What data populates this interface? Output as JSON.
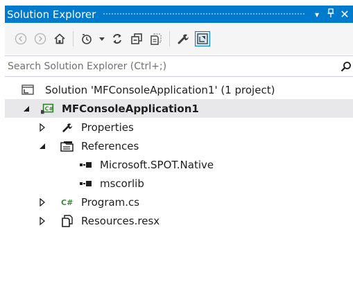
{
  "window": {
    "title": "Solution Explorer",
    "pin_glyph": "॰",
    "dropdown_glyph": "▾",
    "close_glyph": "✕"
  },
  "toolbar": {
    "buttons": [
      {
        "icon": "back-icon"
      },
      {
        "icon": "forward-icon"
      },
      {
        "icon": "home-icon"
      },
      {
        "icon": "pending-changes-filter-icon"
      },
      {
        "icon": "sync-icon"
      },
      {
        "icon": "collapse-all-icon"
      },
      {
        "icon": "show-all-files-icon"
      },
      {
        "icon": "properties-icon"
      },
      {
        "icon": "preview-selected-items-icon",
        "active": true
      }
    ]
  },
  "search": {
    "placeholder": "Search Solution Explorer (Ctrl+;)"
  },
  "tree": {
    "solution": {
      "label": "Solution 'MFConsoleApplication1' (1 project)",
      "icon": "solution-icon"
    },
    "project": {
      "label": "MFConsoleApplication1",
      "icon": "csharp-project-icon",
      "expanded": true,
      "selected": true
    },
    "properties": {
      "label": "Properties",
      "icon": "wrench-icon",
      "expanded": false
    },
    "references": {
      "label": "References",
      "icon": "references-folder-icon",
      "expanded": true
    },
    "ref_items": [
      {
        "label": "Microsoft.SPOT.Native",
        "icon": "assembly-reference-icon"
      },
      {
        "label": "mscorlib",
        "icon": "assembly-reference-icon"
      }
    ],
    "program": {
      "label": "Program.cs",
      "icon": "csharp-file-icon",
      "expanded": false
    },
    "resources": {
      "label": "Resources.resx",
      "icon": "resx-file-icon",
      "expanded": false
    }
  },
  "colors": {
    "accent": "#007acc",
    "selection": "#e8e8ea",
    "csharp_green": "#388a34"
  }
}
